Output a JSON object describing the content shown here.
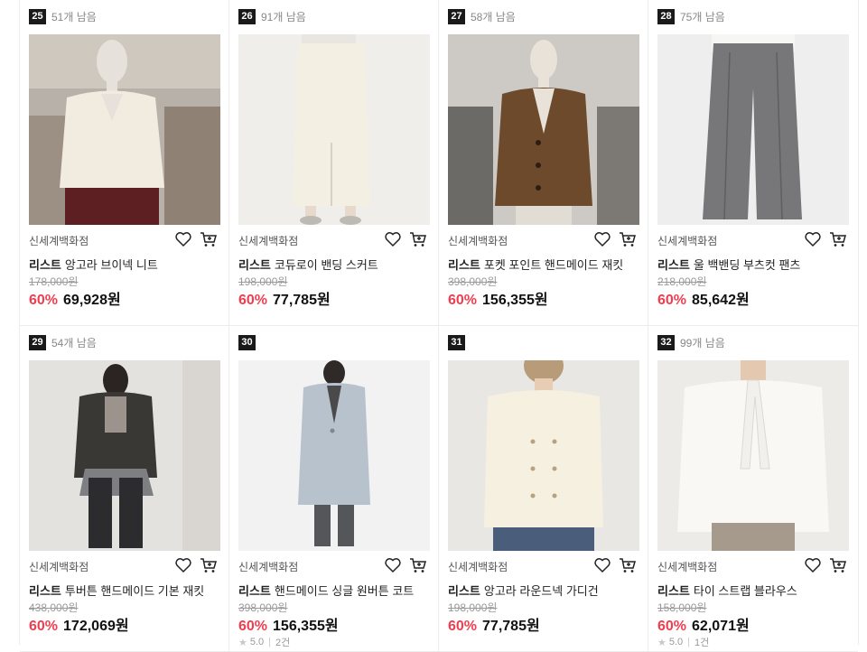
{
  "products": [
    {
      "rank": "25",
      "stock": "51개 남음",
      "store": "신세계백화점",
      "brand": "리스트",
      "name": "앙고라 브이넥 니트",
      "original_price": "178,000원",
      "discount": "60%",
      "price": "69,928원",
      "image": "ivory-v-neck-knit-on-mannequin"
    },
    {
      "rank": "26",
      "stock": "91개 남음",
      "store": "신세계백화점",
      "brand": "리스트",
      "name": "코듀로이 밴딩 스커트",
      "original_price": "198,000원",
      "discount": "60%",
      "price": "77,785원",
      "image": "cream-corduroy-skirt"
    },
    {
      "rank": "27",
      "stock": "58개 남음",
      "store": "신세계백화점",
      "brand": "리스트",
      "name": "포켓 포인트 핸드메이드 재킷",
      "original_price": "398,000원",
      "discount": "60%",
      "price": "156,355원",
      "image": "brown-handmade-jacket-on-mannequin"
    },
    {
      "rank": "28",
      "stock": "75개 남음",
      "store": "신세계백화점",
      "brand": "리스트",
      "name": "울 백밴딩 부츠컷 팬츠",
      "original_price": "218,000원",
      "discount": "60%",
      "price": "85,642원",
      "image": "grey-bootcut-pants"
    },
    {
      "rank": "29",
      "stock": "54개 남음",
      "store": "신세계백화점",
      "brand": "리스트",
      "name": "투버튼 핸드메이드 기본 재킷",
      "original_price": "438,000원",
      "discount": "60%",
      "price": "172,069원",
      "image": "dark-two-button-jacket"
    },
    {
      "rank": "30",
      "stock": "",
      "store": "신세계백화점",
      "brand": "리스트",
      "name": "핸드메이드 싱글 원버튼 코트",
      "original_price": "398,000원",
      "discount": "60%",
      "price": "156,355원",
      "rating": "5.0",
      "reviews": "2건",
      "image": "light-blue-single-coat"
    },
    {
      "rank": "31",
      "stock": "",
      "store": "신세계백화점",
      "brand": "리스트",
      "name": "앙고라 라운드넥 가디건",
      "original_price": "198,000원",
      "discount": "60%",
      "price": "77,785원",
      "image": "ivory-round-neck-cardigan"
    },
    {
      "rank": "32",
      "stock": "99개 남음",
      "store": "신세계백화점",
      "brand": "리스트",
      "name": "타이 스트랩 블라우스",
      "original_price": "158,000원",
      "discount": "60%",
      "price": "62,071원",
      "rating": "5.0",
      "reviews": "1건",
      "image": "white-tie-strap-blouse"
    }
  ],
  "icons": {
    "wishlist": "heart-icon",
    "cart": "cart-icon",
    "rating": "star-icon"
  },
  "colors": {
    "discount": "#ee3e4f",
    "rank_badge": "#1a1a1a"
  }
}
